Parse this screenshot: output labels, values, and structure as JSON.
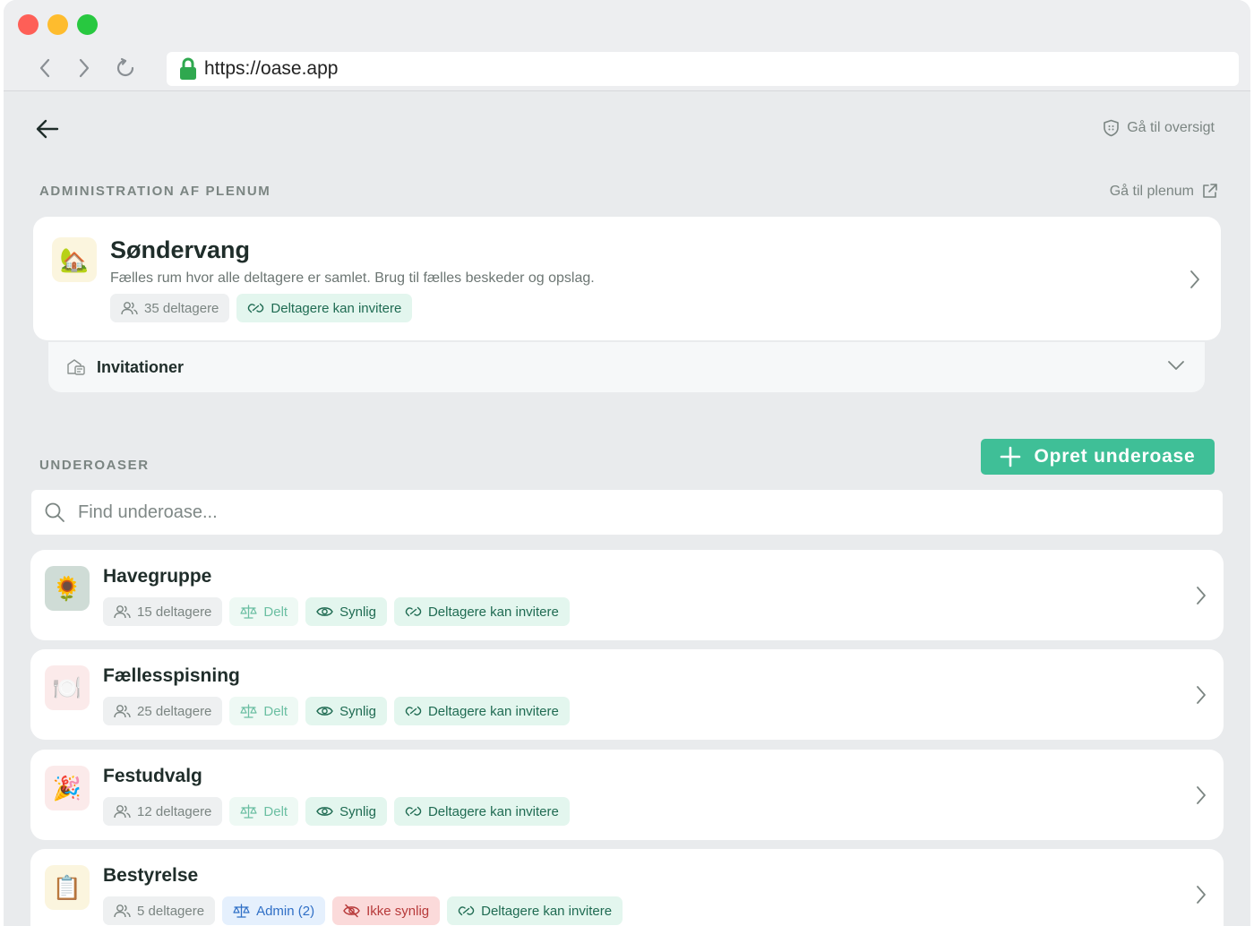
{
  "browser": {
    "url": "https://oase.app"
  },
  "header": {
    "overview_label": "Gå til oversigt"
  },
  "plenum_section": {
    "label": "ADMINISTRATION AF PLENUM",
    "goto_label": "Gå til plenum",
    "card": {
      "emoji": "🏡",
      "title": "Søndervang",
      "description": "Fælles rum hvor alle deltagere er samlet. Brug til fælles beskeder og opslag.",
      "tags": [
        "35 deltagere",
        "Deltagere kan invitere"
      ]
    },
    "invitations_label": "Invitationer"
  },
  "sub_section": {
    "label": "UNDEROASER",
    "create_label": "Opret underoase",
    "search_placeholder": "Find underoase...",
    "items": [
      {
        "emoji": "🌻",
        "title": "Havegruppe",
        "tags": [
          "15 deltagere",
          "Delt",
          "Synlig",
          "Deltagere kan invitere"
        ]
      },
      {
        "emoji": "🍽️",
        "title": "Fællesspisning",
        "tags": [
          "25 deltagere",
          "Delt",
          "Synlig",
          "Deltagere kan invitere"
        ]
      },
      {
        "emoji": "🎉",
        "title": "Festudvalg",
        "tags": [
          "12 deltagere",
          "Delt",
          "Synlig",
          "Deltagere kan invitere"
        ]
      },
      {
        "emoji": "📋",
        "title": "Bestyrelse",
        "tags": [
          "5 deltagere",
          "Admin (2)",
          "Ikke synlig",
          "Deltagere kan invitere"
        ]
      }
    ]
  },
  "colors": {
    "accent": "#3fbf97",
    "page_background": "#e9ebed",
    "hidden_tag": "#fbdada",
    "admin_tag": "#e5f0fd"
  }
}
